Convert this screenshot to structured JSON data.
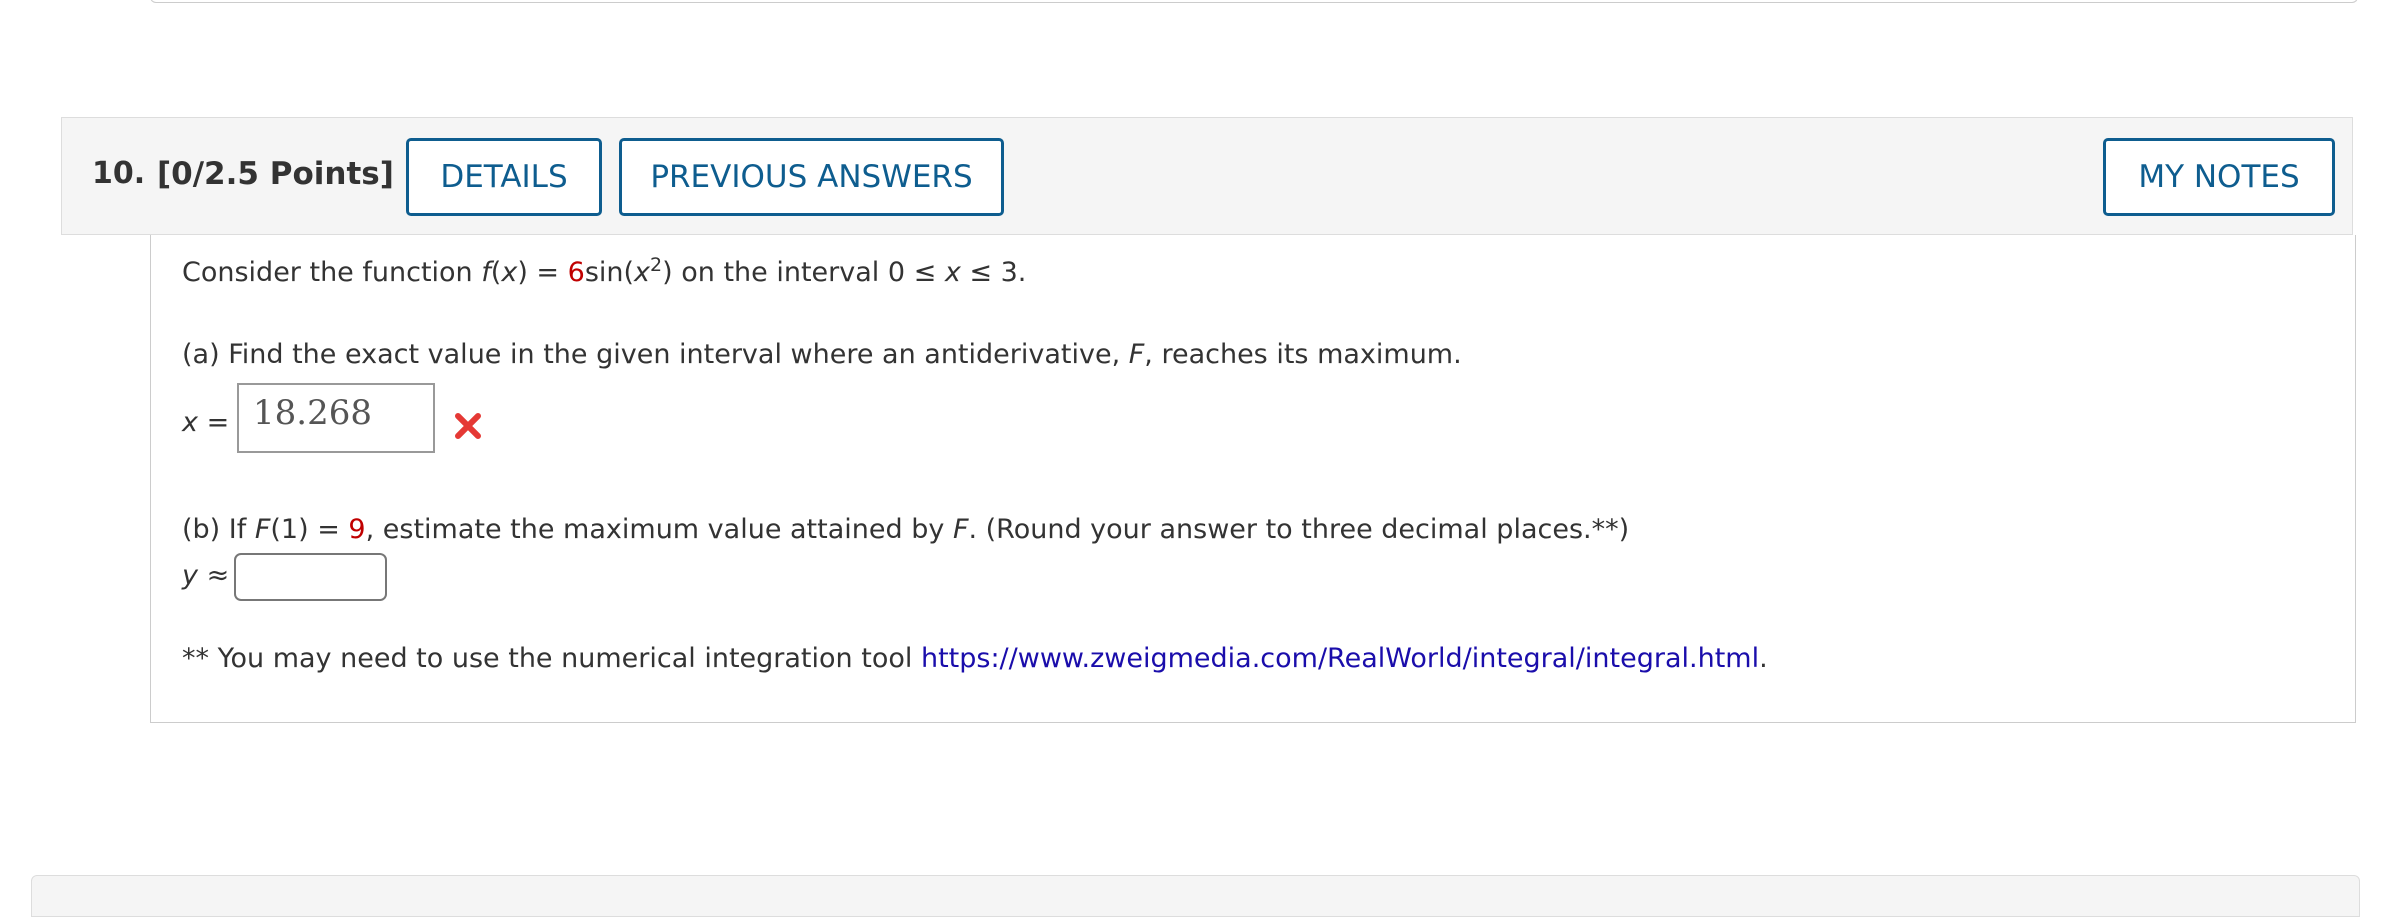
{
  "question": {
    "number": "10.",
    "points": "[0/2.5 Points]",
    "buttons": {
      "details": "DETAILS",
      "previous_answers": "PREVIOUS ANSWERS",
      "my_notes": "MY NOTES"
    }
  },
  "body": {
    "intro": {
      "t1": "Consider the function ",
      "f": "f",
      "t2": "(",
      "x1": "x",
      "t3": ") = ",
      "coef": "6",
      "t4": "sin(",
      "x2": "x",
      "exp": "2",
      "t5": ") on the interval 0 ≤ ",
      "x3": "x",
      "t6": " ≤ 3."
    },
    "part_a": {
      "t1": "(a) Find the exact value in the given interval where an antiderivative, ",
      "F": "F",
      "t2": ", reaches its maximum.",
      "var": "x",
      "eq": " =",
      "answer": "18.268",
      "status_icon": "wrong-x-icon",
      "status_color": "#e53935"
    },
    "part_b": {
      "t1": "(b) If ",
      "F1": "F",
      "t2": "(1) = ",
      "val": "9",
      "t3": ", estimate the maximum value attained by ",
      "F2": "F",
      "t4": ". (Round your answer to three decimal places.**)",
      "var": "y",
      "approx": " ≈",
      "input_value": ""
    },
    "note": {
      "text": "** You may need to use the numerical integration tool ",
      "link": "https://www.zweigmedia.com/RealWorld/integral/integral.html",
      "end": "."
    }
  },
  "colors": {
    "accent": "#0e5d8f",
    "red": "#c00000",
    "link": "#1a0dab"
  }
}
